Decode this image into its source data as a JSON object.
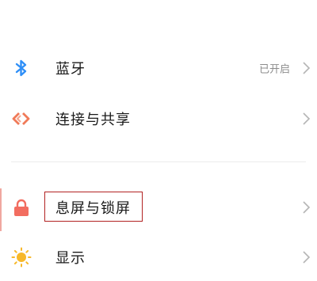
{
  "settings": {
    "items": [
      {
        "label": "蓝牙",
        "status": "已开启",
        "icon": "bluetooth-icon",
        "icon_color": "#2f8ff7"
      },
      {
        "label": "连接与共享",
        "status": "",
        "icon": "connection-sharing-icon",
        "icon_color": "#f07a58"
      },
      {
        "label": "息屏与锁屏",
        "status": "",
        "icon": "lock-icon",
        "icon_color": "#f26d60"
      },
      {
        "label": "显示",
        "status": "",
        "icon": "sun-icon",
        "icon_color": "#f7b82a"
      }
    ]
  },
  "colors": {
    "highlight_border": "#b22222",
    "chevron": "#b5b5b5",
    "status_text": "#8c8c8c"
  }
}
